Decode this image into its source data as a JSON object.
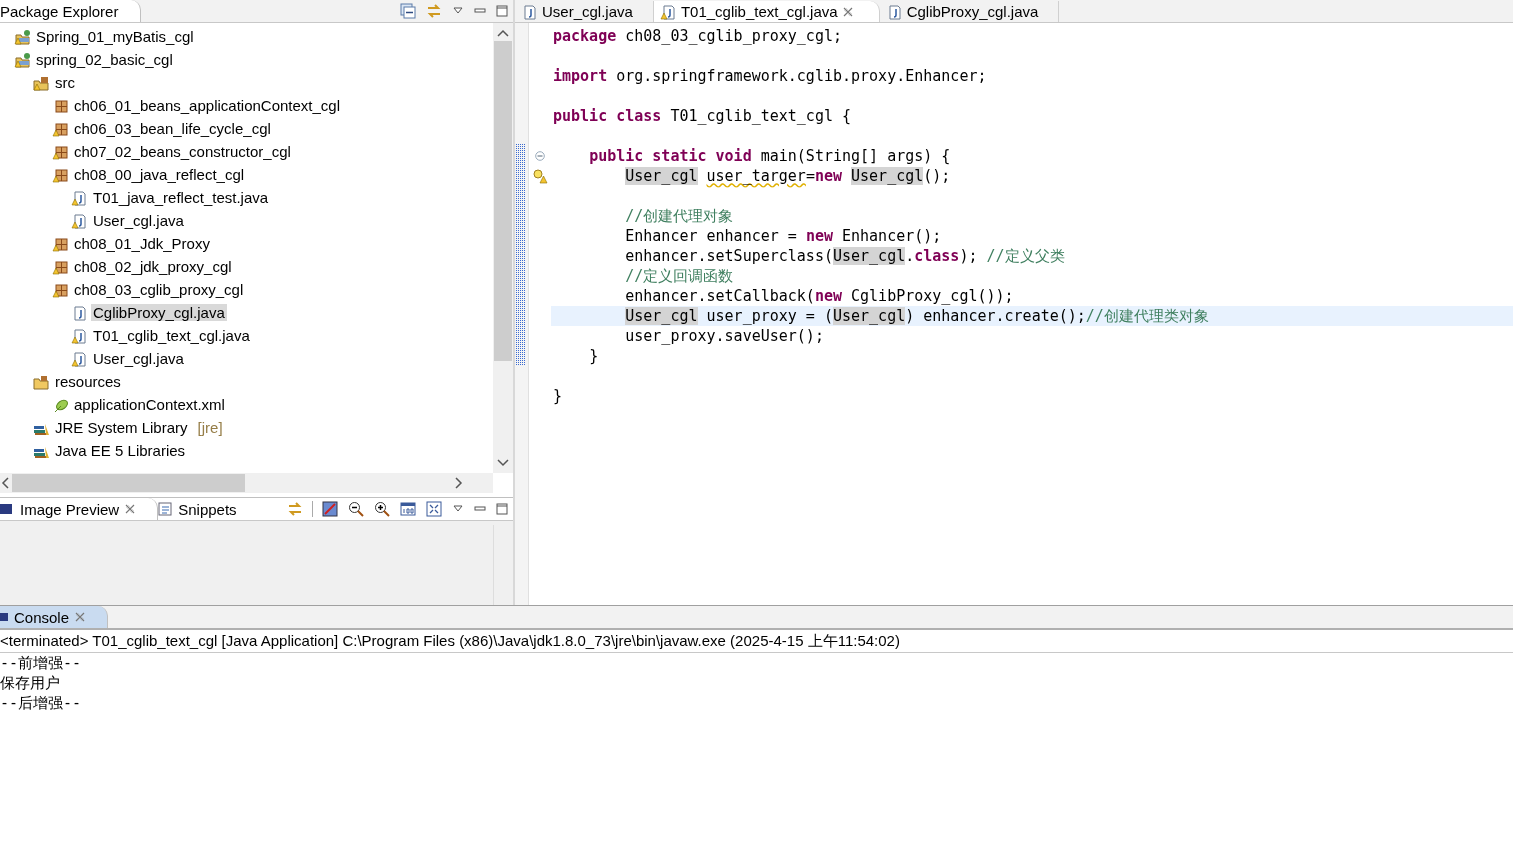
{
  "package_explorer": {
    "title": "Package Explorer",
    "tree": [
      {
        "label": "Spring_01_myBatis_cgl",
        "kind": "project",
        "warning": true,
        "selected": false
      },
      {
        "label": "spring_02_basic_cgl",
        "kind": "project",
        "warning": true,
        "selected": false,
        "children": [
          {
            "label": "src",
            "kind": "source-folder",
            "warning": true,
            "selected": false,
            "children": [
              {
                "label": "ch06_01_beans_applicationContext_cgl",
                "kind": "package",
                "warning": false,
                "selected": false
              },
              {
                "label": "ch06_03_bean_life_cycle_cgl",
                "kind": "package",
                "warning": true,
                "selected": false
              },
              {
                "label": "ch07_02_beans_constructor_cgl",
                "kind": "package",
                "warning": true,
                "selected": false
              },
              {
                "label": "ch08_00_java_reflect_cgl",
                "kind": "package",
                "warning": true,
                "selected": false,
                "children": [
                  {
                    "label": "T01_java_reflect_test.java",
                    "kind": "java-file",
                    "warning": true,
                    "selected": false
                  },
                  {
                    "label": "User_cgl.java",
                    "kind": "java-file",
                    "warning": true,
                    "selected": false
                  }
                ]
              },
              {
                "label": "ch08_01_Jdk_Proxy",
                "kind": "package",
                "warning": true,
                "selected": false
              },
              {
                "label": "ch08_02_jdk_proxy_cgl",
                "kind": "package",
                "warning": true,
                "selected": false
              },
              {
                "label": "ch08_03_cglib_proxy_cgl",
                "kind": "package",
                "warning": true,
                "selected": false,
                "children": [
                  {
                    "label": "CglibProxy_cgl.java",
                    "kind": "java-file",
                    "warning": false,
                    "selected": true
                  },
                  {
                    "label": "T01_cglib_text_cgl.java",
                    "kind": "java-file",
                    "warning": true,
                    "selected": false
                  },
                  {
                    "label": "User_cgl.java",
                    "kind": "java-file",
                    "warning": true,
                    "selected": false
                  }
                ]
              }
            ]
          },
          {
            "label": "resources",
            "kind": "folder",
            "warning": false,
            "selected": false,
            "children": [
              {
                "label": "applicationContext.xml",
                "kind": "xml-file",
                "warning": false,
                "selected": false
              }
            ]
          },
          {
            "label": "JRE System Library",
            "suffix": "[jre]",
            "kind": "library",
            "warning": false,
            "selected": false
          },
          {
            "label": "Java EE 5 Libraries",
            "kind": "library",
            "warning": false,
            "selected": false
          }
        ]
      }
    ]
  },
  "image_preview": {
    "tabs": [
      {
        "label": "Image Preview",
        "selected": true
      },
      {
        "label": "Snippets",
        "selected": false
      }
    ]
  },
  "editor": {
    "tabs": [
      {
        "label": "User_cgl.java",
        "warning": false,
        "selected": false
      },
      {
        "label": "T01_cglib_text_cgl.java",
        "warning": true,
        "selected": true
      },
      {
        "label": "CglibProxy_cgl.java",
        "warning": false,
        "selected": false
      }
    ],
    "lines": [
      {
        "current": false,
        "tokens": [
          {
            "kind": "kw",
            "t": "package"
          },
          {
            "kind": "plain",
            "t": " ch08_03_cglib_proxy_cgl;"
          }
        ]
      },
      {
        "current": false
      },
      {
        "current": false,
        "tokens": [
          {
            "kind": "kw",
            "t": "import"
          },
          {
            "kind": "plain",
            "t": " org.springframework.cglib.proxy.Enhancer;"
          }
        ]
      },
      {
        "current": false
      },
      {
        "current": false,
        "tokens": [
          {
            "kind": "kw",
            "t": "public class"
          },
          {
            "kind": "plain",
            "t": " T01_cglib_text_cgl {"
          }
        ]
      },
      {
        "current": false
      },
      {
        "current": false,
        "kind": "fold",
        "tokens": [
          {
            "kind": "kw",
            "t": "    public static void"
          },
          {
            "kind": "plain",
            "t": " main(String[] args) {"
          }
        ]
      },
      {
        "current": false,
        "kind": "warning",
        "tokens": [
          {
            "kind": "ref",
            "t": "        User_cgl"
          },
          {
            "kind": "warn",
            "t": " user_targer"
          },
          {
            "kind": "plain",
            "t": "="
          },
          {
            "kind": "kw",
            "t": "new"
          },
          {
            "kind": "ref",
            "t": " User_cgl"
          },
          {
            "kind": "plain",
            "t": "();"
          }
        ]
      },
      {
        "current": false
      },
      {
        "current": false,
        "tokens": [
          {
            "kind": "comment",
            "t": "        //创建代理对象"
          }
        ]
      },
      {
        "current": false,
        "tokens": [
          {
            "kind": "plain",
            "t": "        Enhancer enhancer = "
          },
          {
            "kind": "kw",
            "t": "new"
          },
          {
            "kind": "plain",
            "t": " Enhancer();"
          }
        ]
      },
      {
        "current": false,
        "tokens": [
          {
            "kind": "plain",
            "t": "        enhancer.setSuperclass("
          },
          {
            "kind": "ref",
            "t": "User_cgl"
          },
          {
            "kind": "plain",
            "t": "."
          },
          {
            "kind": "kw",
            "t": "class"
          },
          {
            "kind": "plain",
            "t": "); "
          },
          {
            "kind": "comment",
            "t": "//定义父类"
          }
        ]
      },
      {
        "current": false,
        "tokens": [
          {
            "kind": "comment",
            "t": "        //定义回调函数"
          }
        ]
      },
      {
        "current": false,
        "tokens": [
          {
            "kind": "plain",
            "t": "        enhancer.setCallback("
          },
          {
            "kind": "kw",
            "t": "new"
          },
          {
            "kind": "plain",
            "t": " CglibProxy_cgl());"
          }
        ]
      },
      {
        "current": true,
        "tokens": [
          {
            "kind": "ref",
            "t": "        User_cgl"
          },
          {
            "kind": "plain",
            "t": " user_proxy = ("
          },
          {
            "kind": "ref",
            "t": "User_cgl"
          },
          {
            "kind": "plain",
            "t": ") enhancer.create();"
          },
          {
            "kind": "comment",
            "t": "//创建代理类对象"
          }
        ]
      },
      {
        "current": false,
        "tokens": [
          {
            "kind": "plain",
            "t": "        user_proxy.saveUser();"
          }
        ]
      },
      {
        "current": false,
        "tokens": [
          {
            "kind": "plain",
            "t": "    }"
          }
        ]
      },
      {
        "current": false
      },
      {
        "current": false,
        "tokens": [
          {
            "kind": "plain",
            "t": "}"
          }
        ]
      }
    ]
  },
  "console": {
    "title": "Console",
    "header": "<terminated> T01_cglib_text_cgl [Java Application] C:\\Program Files (x86)\\Java\\jdk1.8.0_73\\jre\\bin\\javaw.exe (2025-4-15 上午11:54:02)",
    "output": [
      "--前增强--",
      "保存用户",
      "--后增强--"
    ]
  }
}
